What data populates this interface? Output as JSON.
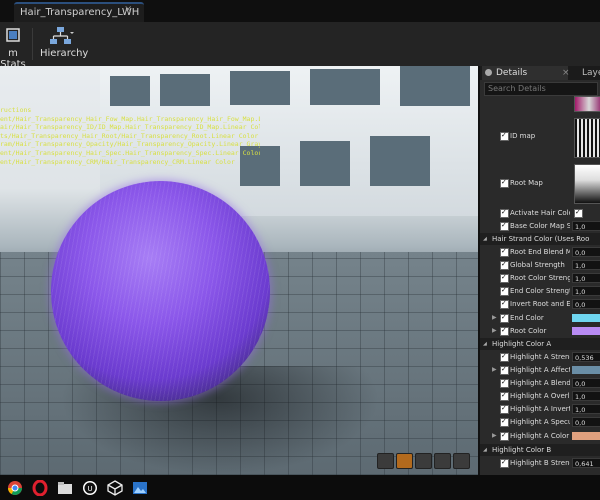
{
  "app": {
    "tab_title": "Hair_Transparency_LWH",
    "tab_close": "×"
  },
  "toolbar": {
    "stats_label": "m Stats",
    "hierarchy_label": "Hierarchy"
  },
  "viewport": {
    "debug_lines": [
      "ructions",
      "ent/Hair_Transparency_Hair_Fow_Map.Hair_Transparency_Hair_Fow_Map.Linear Color",
      "air/Hair_Transparency_ID/ID_Map.Hair_Transparency_ID_Map.Linear Color",
      "ts/Hair_Transparency_Hair_Root/Hair_Transparency_Root.Linear Color",
      "ram/Hair_Transparency_Opacity/Hair_Transparency_Opacity.Linear Grayscale",
      "ent/Hair_Transparency_Hair_Spec.Hair_Transparency_Spec.Linear Color",
      "ent/Hair_Transparency_CRM/Hair_Transparency_CRM.Linear Color"
    ]
  },
  "details": {
    "tab_label": "Details",
    "tab_close": "×",
    "layers_tab_label": "Laye",
    "search_placeholder": "Search Details",
    "id_map_label": "ID map",
    "root_map_label": "Root Map",
    "activate_hair_color_label": "Activate Hair Color",
    "base_color_map_strength_label": "Base Color Map Streng",
    "base_color_map_strength_value": "1,0",
    "hair_strand_section": "Hair Strand Color (Uses Roo",
    "root_end_blend_label": "Root End Blend Mode",
    "root_end_blend_value": "0,0",
    "global_strength_label": "Global Strength",
    "global_strength_value": "1,0",
    "root_color_strength_label": "Root Color Strength",
    "root_color_strength_value": "1,0",
    "end_color_strength_label": "End Color Strength",
    "end_color_strength_value": "1,0",
    "invert_root_end_label": "Invert Root and End Col",
    "invert_root_end_value": "0,0",
    "end_color_label": "End Color",
    "end_color": "#6fd6f0",
    "root_color_label": "Root Color",
    "root_color": "#b88bf3",
    "highlight_a_section": "Highlight Color A",
    "highlight_a_strength_label": "Highlight A Strength",
    "highlight_a_strength_value": "0,536",
    "highlight_a_affected_label": "Highlight A Affected Ra",
    "highlight_a_affected_color": "#6a8ea6",
    "highlight_a_blend_label": "Highlight A Blend Mode",
    "highlight_a_blend_value": "0,0",
    "highlight_a_overlap_label": "Highlight A Overlap End",
    "highlight_a_overlap_value": "1,0",
    "highlight_a_invert_label": "Highlight A Invert End t",
    "highlight_a_invert_value": "1,0",
    "highlight_a_specular_label": "Highlight A Specular St",
    "highlight_a_specular_value": "0,0",
    "highlight_a_color_label": "Highlight A Color",
    "highlight_a_color": "#e0a07e",
    "highlight_b_section": "Highlight Color B",
    "highlight_b_strength_label": "Highlight B Strength",
    "highlight_b_strength_value": "0,641"
  },
  "taskbar": {
    "items": [
      "chrome-icon",
      "opera-icon",
      "files-icon",
      "unreal-icon",
      "cube-icon",
      "image-icon"
    ]
  },
  "colors": {
    "accent_tab": "#2b4f7d",
    "hair": "#8b57ea"
  }
}
